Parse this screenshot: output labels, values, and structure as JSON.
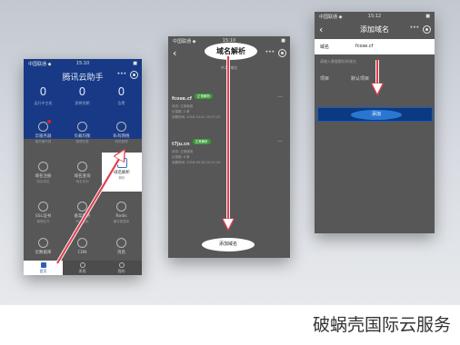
{
  "screen1": {
    "status": {
      "carrier": "中国联通 ◆",
      "time": "15:10",
      "battery": "■"
    },
    "title": "腾讯云助手",
    "stats": [
      {
        "value": "0",
        "label": "运行中主机"
      },
      {
        "value": "0",
        "label": "即将到期"
      },
      {
        "value": "0",
        "label": "告警"
      }
    ],
    "grid": [
      {
        "label": "云服务器",
        "sub": "服务器列表"
      },
      {
        "label": "负载均衡",
        "sub": "管理负载"
      },
      {
        "label": "私有网络",
        "sub": "网络管理"
      },
      {
        "label": "域名注册",
        "sub": "购买域名"
      },
      {
        "label": "域名查询",
        "sub": "域名查询"
      },
      {
        "label": "域名解析",
        "sub": "解析"
      },
      {
        "label": "SSL证书",
        "sub": "管理证书"
      },
      {
        "label": "备案服务",
        "sub": "网站备案"
      },
      {
        "label": "Redis",
        "sub": "缓存数据库"
      },
      {
        "label": "云数据库",
        "sub": "数据库"
      },
      {
        "label": "CDN",
        "sub": "内容分发"
      },
      {
        "label": "消息",
        "sub": "站内信"
      }
    ],
    "tabs": [
      {
        "label": "首页"
      },
      {
        "label": "发现"
      },
      {
        "label": "我的"
      }
    ]
  },
  "screen2": {
    "status": {
      "carrier": "中国联通 ◆",
      "time": "15:10",
      "battery": "■"
    },
    "title": "域名解析",
    "count": "共2个域名",
    "domains": [
      {
        "name": "fcose.cf",
        "status": "正常解析",
        "lines": [
          "状态: 正常使用",
          "记录数: 2 条",
          "到期时间: 2018-10-01 10:07:22"
        ]
      },
      {
        "name": "t7ju.cn",
        "status": "正常解析",
        "lines": [
          "状态: 正常使用",
          "记录数: 8 条",
          "到期时间: 2018-09-28 10:21:30"
        ]
      }
    ],
    "add_button": "添加域名"
  },
  "screen3": {
    "status": {
      "carrier": "中国联通 ◆",
      "time": "15:12",
      "battery": "■"
    },
    "title": "添加域名",
    "fields": [
      {
        "label": "域名",
        "value": "fcose.cf"
      },
      {
        "label": "项目",
        "value": "默认项目"
      }
    ],
    "hint": "请输入需要解析的域名",
    "submit": "添加"
  },
  "watermark": "破蜗壳国际云服务",
  "colors": {
    "accent": "#183a86",
    "arrow": "#e04050",
    "overlay": "#575757"
  }
}
